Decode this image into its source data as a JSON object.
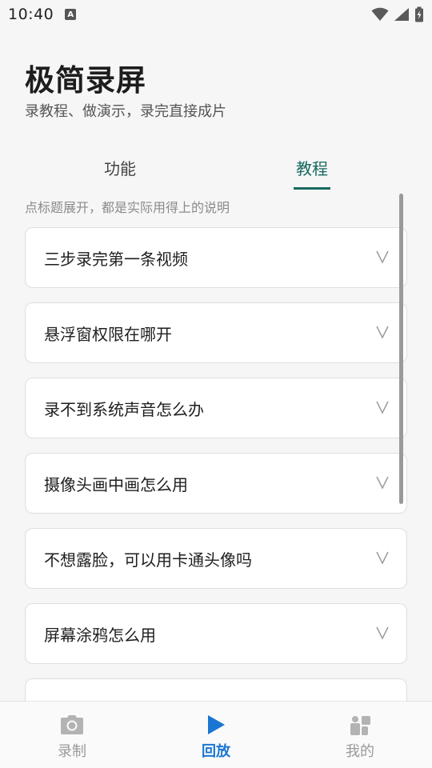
{
  "status_bar": {
    "time": "10:40",
    "notification_icon_letter": "A",
    "icons": [
      "wifi-icon",
      "signal-icon",
      "battery-charging-icon"
    ]
  },
  "header": {
    "title": "极简录屏",
    "subtitle": "录教程、做演示，录完直接成片"
  },
  "tabs": [
    {
      "label": "功能",
      "selected": false
    },
    {
      "label": "教程",
      "selected": true
    }
  ],
  "hint": "点标题展开，都是实际用得上的说明",
  "faq_items": [
    {
      "title": "三步录完第一条视频"
    },
    {
      "title": "悬浮窗权限在哪开"
    },
    {
      "title": "录不到系统声音怎么办"
    },
    {
      "title": "摄像头画中画怎么用"
    },
    {
      "title": "不想露脸，可以用卡通头像吗"
    },
    {
      "title": "屏幕涂鸦怎么用"
    }
  ],
  "bottom_nav": [
    {
      "label": "录制",
      "icon": "camera-icon",
      "active": false
    },
    {
      "label": "回放",
      "icon": "play-icon",
      "active": true
    },
    {
      "label": "我的",
      "icon": "profile-icon",
      "active": false
    }
  ],
  "colors": {
    "accent_tab": "#16695f",
    "accent_nav": "#1976d2",
    "inactive_nav": "#9a9a9a",
    "background": "#f6f6f6"
  }
}
